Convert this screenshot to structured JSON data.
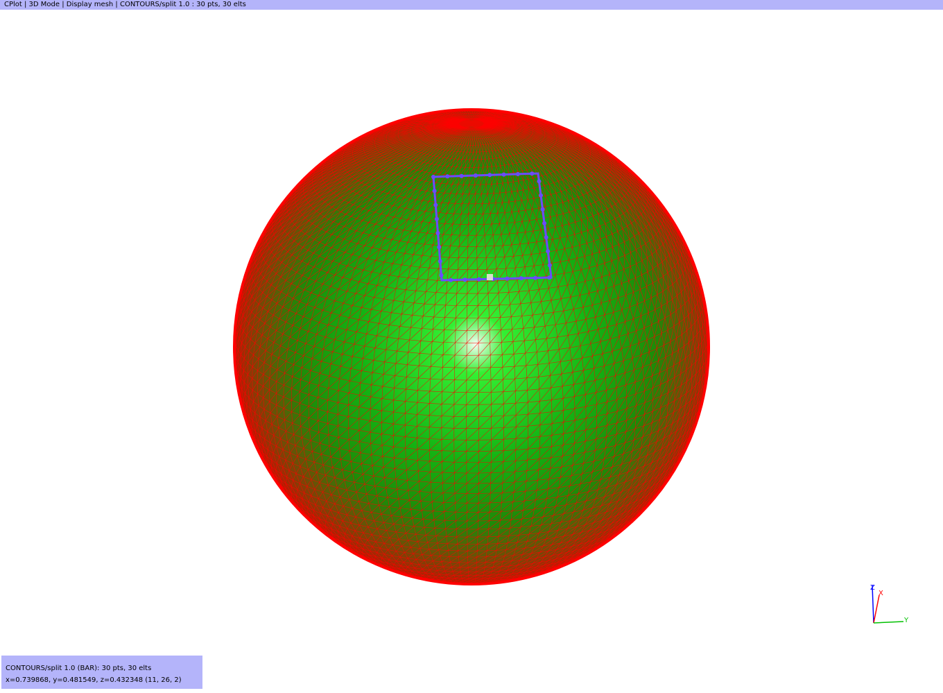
{
  "window": {
    "title": "CPlot | 3D Mode | Display mesh | CONTOURS/split 1.0 : 30 pts, 30 elts"
  },
  "info_panel": {
    "line1": "CONTOURS/split 1.0 (BAR): 30 pts, 30 elts",
    "line2": "x=0.739868, y=0.481549, z=0.432348 (11, 26,  2)"
  },
  "axes_triad": {
    "z_label": "Z",
    "x_label": "X",
    "y_label": "Y",
    "z_color": "#0000ff",
    "x_color": "#ff0000",
    "y_color": "#00c000"
  },
  "scene": {
    "sphere_base_color": "#00a000",
    "mesh_color": "#ff0000",
    "contour_color": "#6a4cff"
  }
}
